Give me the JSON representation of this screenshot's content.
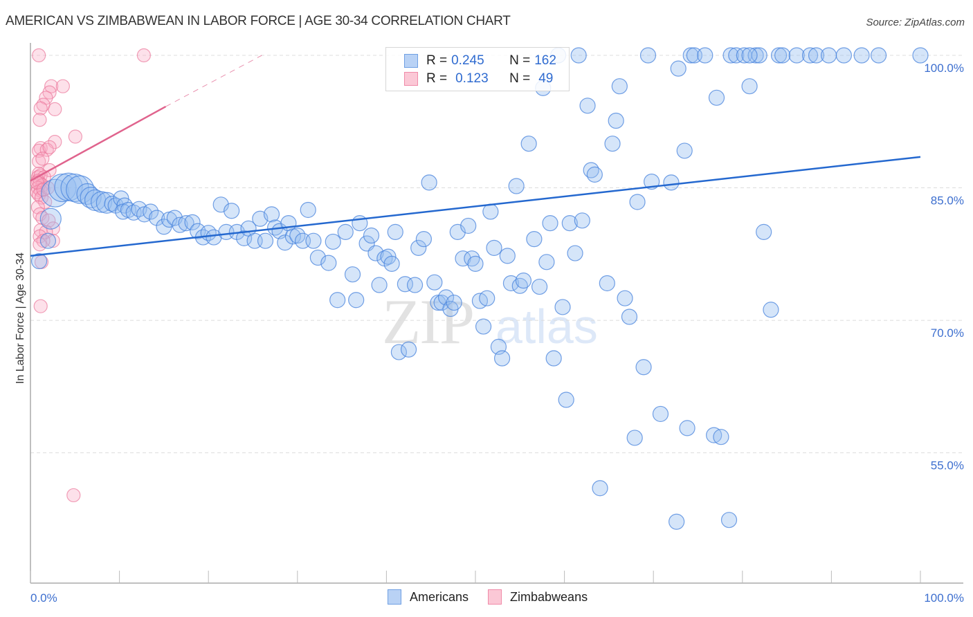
{
  "header": {
    "title": "AMERICAN VS ZIMBABWEAN IN LABOR FORCE | AGE 30-34 CORRELATION CHART",
    "source": "Source: ZipAtlas.com"
  },
  "watermark": {
    "zip": "ZIP",
    "atlas": "atlas"
  },
  "legend": {
    "rows": [
      {
        "r_label": "R = ",
        "r_value": "0.245",
        "n_label": "N = ",
        "n_value": "162"
      },
      {
        "r_label": "R = ",
        "r_value": "0.123",
        "n_label": "N = ",
        "n_value": "49"
      }
    ],
    "bottom": [
      "Americans",
      "Zimbabweans"
    ]
  },
  "chart_data": {
    "type": "scatter",
    "title": "AMERICAN VS ZIMBABWEAN IN LABOR FORCE | AGE 30-34 CORRELATION CHART",
    "xlabel": "",
    "ylabel": "In Labor Force | Age 30-34",
    "xlim": [
      0,
      100
    ],
    "ylim": [
      40.3,
      101.5
    ],
    "x_tick_labels": [
      "0.0%",
      "100.0%"
    ],
    "x_minor_ticks": [
      0,
      10,
      20,
      30,
      40,
      50,
      60,
      70,
      80,
      90,
      100
    ],
    "y_ticks": [
      100,
      85,
      70,
      55
    ],
    "y_tick_labels": [
      "100.0%",
      "85.0%",
      "70.0%",
      "55.0%"
    ],
    "grid": true,
    "legend_position": "top-center",
    "colors": {
      "Americans": "#6f9fe3",
      "Zimbabweans": "#f08aa8",
      "americans_line": "#2468cf",
      "zimbabweans_line": "#e0638d"
    },
    "series": [
      {
        "name": "Americans",
        "R": 0.245,
        "N": 162,
        "trend": {
          "x0": 0,
          "y0": 77.3,
          "x1": 100,
          "y1": 88.5
        },
        "points": [
          [
            0.2,
            76.7,
            1
          ],
          [
            1.5,
            81.5,
            2
          ],
          [
            1.2,
            79.0,
            1
          ],
          [
            2.0,
            84.4,
            3
          ],
          [
            2.8,
            85.0,
            3
          ],
          [
            3.5,
            85.1,
            3
          ],
          [
            4.2,
            85.0,
            3
          ],
          [
            4.8,
            84.8,
            3
          ],
          [
            5.6,
            84.3,
            2
          ],
          [
            6.0,
            83.9,
            2
          ],
          [
            6.5,
            83.6,
            2
          ],
          [
            7.2,
            83.4,
            2
          ],
          [
            7.8,
            83.3,
            2
          ],
          [
            8.4,
            83.2,
            1
          ],
          [
            8.8,
            83.0,
            1
          ],
          [
            9.4,
            83.8,
            1
          ],
          [
            9.8,
            83.0,
            1
          ],
          [
            10.4,
            82.3,
            1
          ],
          [
            11.0,
            82.5,
            1
          ],
          [
            11.6,
            82.2,
            1
          ],
          [
            12.2,
            82.6,
            1
          ],
          [
            12.8,
            82.0,
            1
          ],
          [
            13.5,
            82.3,
            1
          ],
          [
            14.2,
            81.6,
            1
          ],
          [
            15.0,
            80.6,
            1
          ],
          [
            15.6,
            81.4,
            1
          ],
          [
            16.2,
            81.6,
            1
          ],
          [
            16.8,
            80.8,
            1
          ],
          [
            17.5,
            81.0,
            1
          ],
          [
            18.2,
            81.1,
            1
          ],
          [
            18.8,
            80.1,
            1
          ],
          [
            19.4,
            79.4,
            1
          ],
          [
            20.0,
            79.9,
            1
          ],
          [
            20.6,
            79.4,
            1
          ],
          [
            21.4,
            83.1,
            1
          ],
          [
            22.0,
            80.0,
            1
          ],
          [
            22.6,
            82.4,
            1
          ],
          [
            23.2,
            80.0,
            1
          ],
          [
            24.0,
            79.3,
            1
          ],
          [
            24.5,
            80.4,
            1
          ],
          [
            25.2,
            79.0,
            1
          ],
          [
            25.8,
            81.5,
            1
          ],
          [
            26.4,
            79.0,
            1
          ],
          [
            27.1,
            82.0,
            1
          ],
          [
            27.5,
            80.5,
            1
          ],
          [
            28.0,
            80.1,
            1
          ],
          [
            28.6,
            78.8,
            1
          ],
          [
            29.0,
            81.0,
            1
          ],
          [
            29.5,
            79.5,
            1
          ],
          [
            30.0,
            79.6,
            1
          ],
          [
            30.6,
            79.0,
            1
          ],
          [
            31.2,
            82.5,
            1
          ],
          [
            31.8,
            79.0,
            1
          ],
          [
            32.3,
            77.1,
            1
          ],
          [
            33.5,
            76.5,
            1
          ],
          [
            34.0,
            78.9,
            1
          ],
          [
            34.5,
            72.3,
            1
          ],
          [
            35.4,
            80.0,
            1
          ],
          [
            36.2,
            75.2,
            1
          ],
          [
            36.6,
            72.3,
            1
          ],
          [
            37.0,
            81.0,
            1
          ],
          [
            37.8,
            78.7,
            1
          ],
          [
            38.3,
            79.6,
            1
          ],
          [
            38.8,
            77.6,
            1
          ],
          [
            39.2,
            74.0,
            1
          ],
          [
            39.8,
            77.0,
            1
          ],
          [
            40.2,
            77.2,
            1
          ],
          [
            40.6,
            76.4,
            1
          ],
          [
            41.0,
            80.0,
            1
          ],
          [
            41.4,
            66.4,
            1
          ],
          [
            42.1,
            74.1,
            1
          ],
          [
            42.5,
            66.7,
            1
          ],
          [
            43.2,
            74.0,
            1
          ],
          [
            43.6,
            78.2,
            1
          ],
          [
            44.2,
            79.2,
            1
          ],
          [
            44.8,
            85.6,
            1
          ],
          [
            45.4,
            74.3,
            1
          ],
          [
            45.8,
            72.0,
            1
          ],
          [
            46.2,
            72.0,
            1
          ],
          [
            46.7,
            72.6,
            1
          ],
          [
            47.2,
            71.3,
            1
          ],
          [
            47.6,
            72.0,
            1
          ],
          [
            48.0,
            80.0,
            1
          ],
          [
            48.6,
            77.0,
            1
          ],
          [
            49.2,
            80.7,
            1
          ],
          [
            49.6,
            77.0,
            1
          ],
          [
            50.0,
            76.4,
            1
          ],
          [
            50.5,
            72.2,
            1
          ],
          [
            50.9,
            69.3,
            1
          ],
          [
            51.3,
            72.5,
            1
          ],
          [
            51.7,
            82.3,
            1
          ],
          [
            52.1,
            78.2,
            1
          ],
          [
            52.6,
            67.0,
            1
          ],
          [
            53.0,
            65.7,
            1
          ],
          [
            53.6,
            77.3,
            1
          ],
          [
            54.0,
            74.2,
            1
          ],
          [
            54.6,
            85.2,
            1
          ],
          [
            55.0,
            73.9,
            1
          ],
          [
            55.4,
            74.5,
            1
          ],
          [
            56.0,
            90.0,
            1
          ],
          [
            56.6,
            79.2,
            1
          ],
          [
            57.2,
            73.8,
            1
          ],
          [
            57.6,
            96.3,
            1
          ],
          [
            58.0,
            76.6,
            1
          ],
          [
            58.4,
            81.0,
            1
          ],
          [
            58.8,
            65.7,
            1
          ],
          [
            59.3,
            100.0,
            1
          ],
          [
            59.8,
            71.5,
            1
          ],
          [
            60.2,
            61.0,
            1
          ],
          [
            60.6,
            81.0,
            1
          ],
          [
            61.2,
            77.6,
            1
          ],
          [
            61.6,
            100.0,
            1
          ],
          [
            62.0,
            81.3,
            1
          ],
          [
            62.6,
            94.3,
            1
          ],
          [
            63.0,
            87.0,
            1
          ],
          [
            63.4,
            86.5,
            1
          ],
          [
            64.0,
            51.0,
            1
          ],
          [
            64.8,
            74.2,
            1
          ],
          [
            65.4,
            90.0,
            1
          ],
          [
            65.8,
            92.6,
            1
          ],
          [
            66.2,
            96.5,
            1
          ],
          [
            66.8,
            72.5,
            1
          ],
          [
            67.3,
            70.4,
            1
          ],
          [
            67.9,
            56.7,
            1
          ],
          [
            68.2,
            83.4,
            1
          ],
          [
            68.9,
            64.7,
            1
          ],
          [
            69.4,
            100.0,
            1
          ],
          [
            69.8,
            85.7,
            1
          ],
          [
            70.8,
            59.4,
            1
          ],
          [
            72.0,
            85.6,
            1
          ],
          [
            72.6,
            47.2,
            1
          ],
          [
            72.8,
            98.5,
            1
          ],
          [
            73.5,
            89.2,
            1
          ],
          [
            73.8,
            57.8,
            1
          ],
          [
            74.2,
            100.0,
            1
          ],
          [
            74.6,
            100.0,
            1
          ],
          [
            75.8,
            100.0,
            1
          ],
          [
            76.8,
            57.0,
            1
          ],
          [
            77.1,
            95.2,
            1
          ],
          [
            77.6,
            56.8,
            1
          ],
          [
            78.5,
            47.4,
            1
          ],
          [
            78.7,
            100.0,
            1
          ],
          [
            79.3,
            100.0,
            1
          ],
          [
            80.2,
            100.0,
            1
          ],
          [
            80.8,
            96.5,
            1
          ],
          [
            81.5,
            100.0,
            1
          ],
          [
            81.9,
            100.0,
            1
          ],
          [
            80.8,
            100.0,
            1
          ],
          [
            82.4,
            80.0,
            1
          ],
          [
            83.2,
            71.2,
            1
          ],
          [
            84.1,
            100.0,
            1
          ],
          [
            84.5,
            100.0,
            1
          ],
          [
            86.1,
            100.0,
            1
          ],
          [
            87.6,
            100.0,
            1
          ],
          [
            88.3,
            100.0,
            1
          ],
          [
            89.7,
            100.0,
            1
          ],
          [
            91.4,
            100.0,
            1
          ],
          [
            93.4,
            100.0,
            1
          ],
          [
            95.3,
            100.0,
            1
          ],
          [
            100.0,
            100.0,
            1
          ]
        ]
      },
      {
        "name": "Zimbabweans",
        "R": 0.123,
        "N": 49,
        "trend": {
          "x0": 0,
          "y0": 85.8,
          "x1": 15.2,
          "y1": 94.2,
          "dashed_to": {
            "x": 26.0,
            "y": 100.0
          }
        },
        "points": [
          [
            0.4,
            100.0
          ],
          [
            12.2,
            100.0
          ],
          [
            1.8,
            96.5
          ],
          [
            1.6,
            95.8
          ],
          [
            3.1,
            96.5
          ],
          [
            1.2,
            95.2
          ],
          [
            0.9,
            94.4
          ],
          [
            2.2,
            93.9
          ],
          [
            0.6,
            94.0
          ],
          [
            0.5,
            92.7
          ],
          [
            4.5,
            90.8
          ],
          [
            2.2,
            90.2
          ],
          [
            0.6,
            89.5
          ],
          [
            0.4,
            89.2
          ],
          [
            1.3,
            89.3
          ],
          [
            1.6,
            89.6
          ],
          [
            0.4,
            88.0
          ],
          [
            0.8,
            88.3
          ],
          [
            1.6,
            87.0
          ],
          [
            0.4,
            86.6
          ],
          [
            0.3,
            86.2
          ],
          [
            0.6,
            86.4
          ],
          [
            1.0,
            86.2
          ],
          [
            0.3,
            85.8
          ],
          [
            0.5,
            85.5
          ],
          [
            0.8,
            85.3
          ],
          [
            0.3,
            85.0
          ],
          [
            0.6,
            84.7
          ],
          [
            0.2,
            84.5
          ],
          [
            0.4,
            84.2
          ],
          [
            0.7,
            83.9
          ],
          [
            1.1,
            83.4
          ],
          [
            0.3,
            82.8
          ],
          [
            0.5,
            82.0
          ],
          [
            0.8,
            81.6
          ],
          [
            1.5,
            81.3
          ],
          [
            0.6,
            80.2
          ],
          [
            2.0,
            80.4
          ],
          [
            1.2,
            80.0
          ],
          [
            0.5,
            79.5
          ],
          [
            2.0,
            79.0
          ],
          [
            0.9,
            79.0
          ],
          [
            0.5,
            78.6
          ],
          [
            0.7,
            76.6
          ],
          [
            0.6,
            71.6
          ],
          [
            4.3,
            50.2
          ],
          [
            1.4,
            85.0
          ],
          [
            0.2,
            85.6
          ],
          [
            0.9,
            84.8
          ]
        ]
      }
    ]
  }
}
